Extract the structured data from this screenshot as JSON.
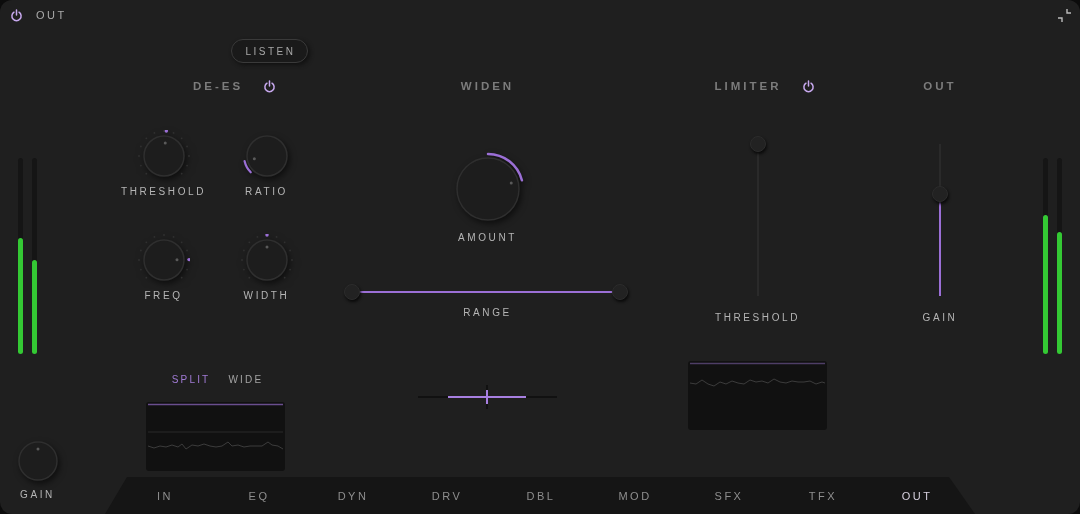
{
  "header": {
    "power": {
      "on": true
    },
    "title": "OUT"
  },
  "meters_left": [
    {
      "level": 0.59
    },
    {
      "level": 0.48
    }
  ],
  "input_gain": {
    "label": "GAIN",
    "level": 0.5
  },
  "de_es": {
    "listen": {
      "label": "LISTEN"
    },
    "title": "DE-ES",
    "power": {
      "on": true
    },
    "knobs": [
      {
        "label": "THRESHOLD",
        "kind": "dots",
        "level": 0.52
      },
      {
        "label": "RATIO",
        "kind": "arc",
        "level": 0.12
      },
      {
        "label": "FREQ",
        "kind": "dots",
        "level": 0.83
      },
      {
        "label": "WIDTH",
        "kind": "dots",
        "level": 0.5
      }
    ],
    "view_tabs": [
      {
        "label": "SPLIT",
        "selected": true
      },
      {
        "label": "WIDE",
        "selected": false
      }
    ]
  },
  "widen": {
    "title": "WIDEN",
    "amount": {
      "label": "AMOUNT",
      "kind": "center-arc",
      "level": 0.78
    },
    "range": {
      "label": "RANGE",
      "thumbs": [
        {
          "level": 0
        },
        {
          "level": 1
        }
      ]
    }
  },
  "limiter": {
    "title": "LIMITER",
    "power": {
      "on": true
    },
    "threshold": {
      "label": "THRESHOLD",
      "level": 1,
      "fill": false
    }
  },
  "out": {
    "title": "OUT",
    "gain": {
      "label": "GAIN",
      "level": 0.67,
      "fill": true
    }
  },
  "meters_right": [
    {
      "level": 0.71
    },
    {
      "level": 0.62
    }
  ],
  "tabs": [
    {
      "label": "IN",
      "selected": false
    },
    {
      "label": "EQ",
      "selected": false
    },
    {
      "label": "DYN",
      "selected": false
    },
    {
      "label": "DRV",
      "selected": false
    },
    {
      "label": "DBL",
      "selected": false
    },
    {
      "label": "MOD",
      "selected": false
    },
    {
      "label": "SFX",
      "selected": false
    },
    {
      "label": "TFX",
      "selected": false
    },
    {
      "label": "OUT",
      "selected": true
    }
  ]
}
